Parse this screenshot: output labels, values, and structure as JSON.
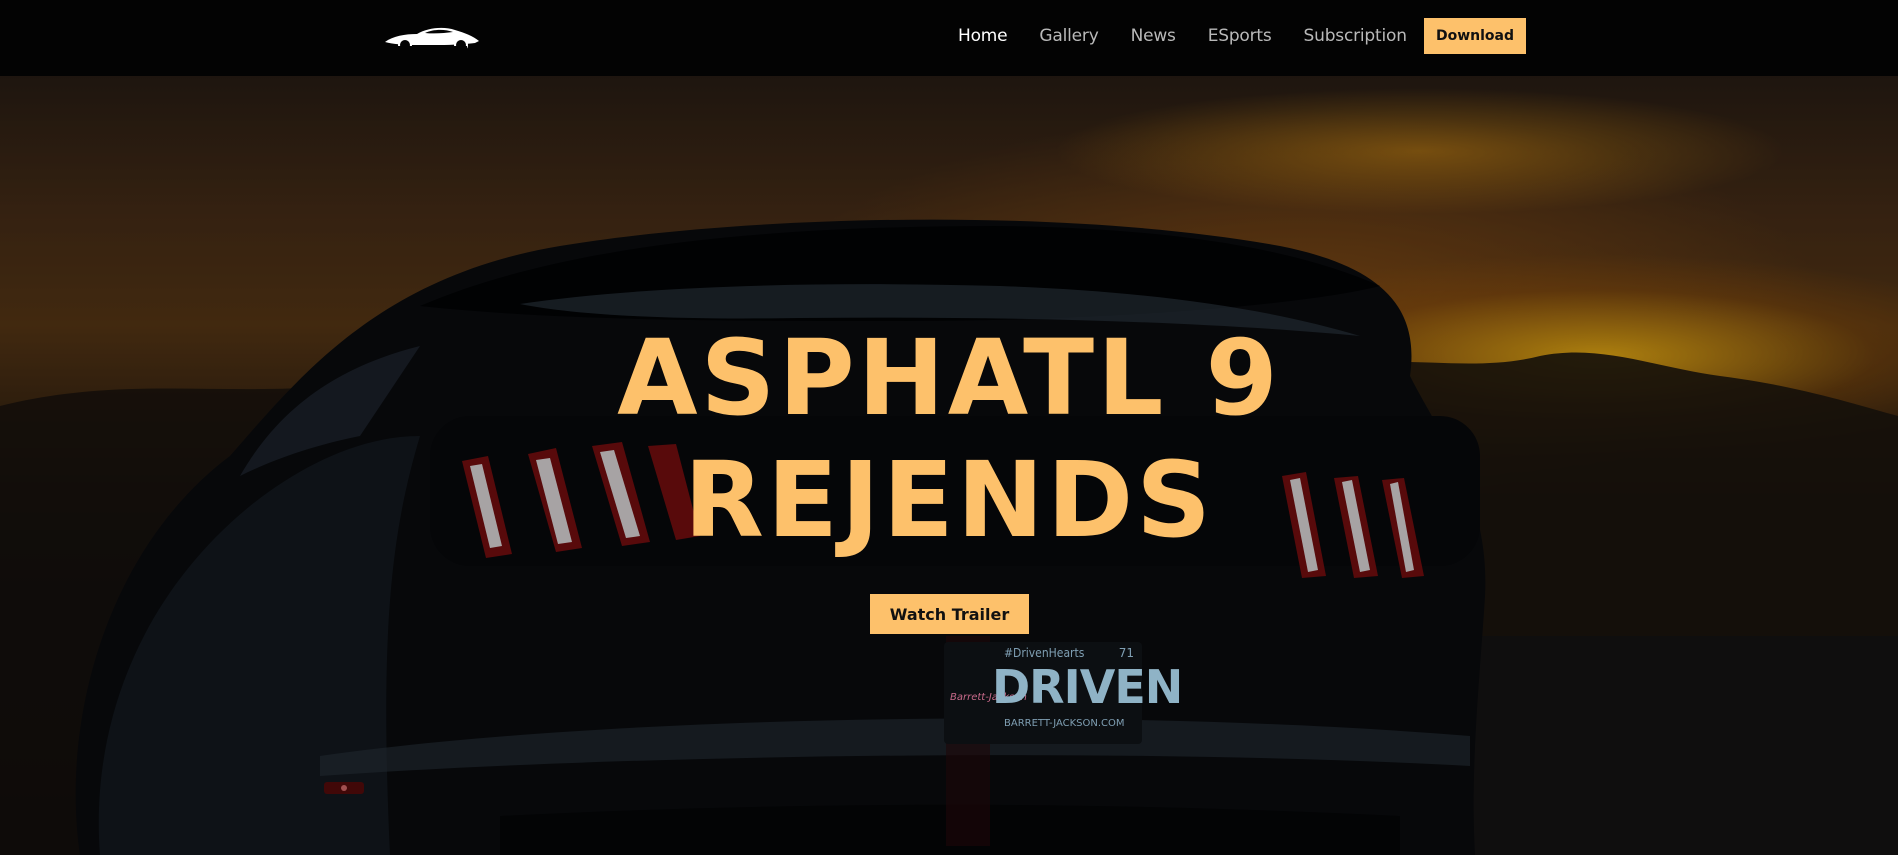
{
  "nav": {
    "logo_icon": "car-silhouette-icon",
    "links": [
      {
        "label": "Home",
        "active": true
      },
      {
        "label": "Gallery",
        "active": false
      },
      {
        "label": "News",
        "active": false
      },
      {
        "label": "ESports",
        "active": false
      },
      {
        "label": "Subscription",
        "active": false
      }
    ],
    "download_label": "Download"
  },
  "hero": {
    "title_line1": "ASPHATL 9",
    "title_line2": "REJENDS",
    "trailer_label": "Watch Trailer",
    "plate": {
      "tag": "#DrivenHearts",
      "number": "71",
      "word": "DRIVEN",
      "site": "BARRETT-JACKSON.COM",
      "script": "Barrett-Jackson"
    }
  },
  "colors": {
    "accent": "#fdc16b",
    "nav_bg": "#030303",
    "nav_text": "#b9b9b9",
    "nav_active": "#ffffff"
  }
}
